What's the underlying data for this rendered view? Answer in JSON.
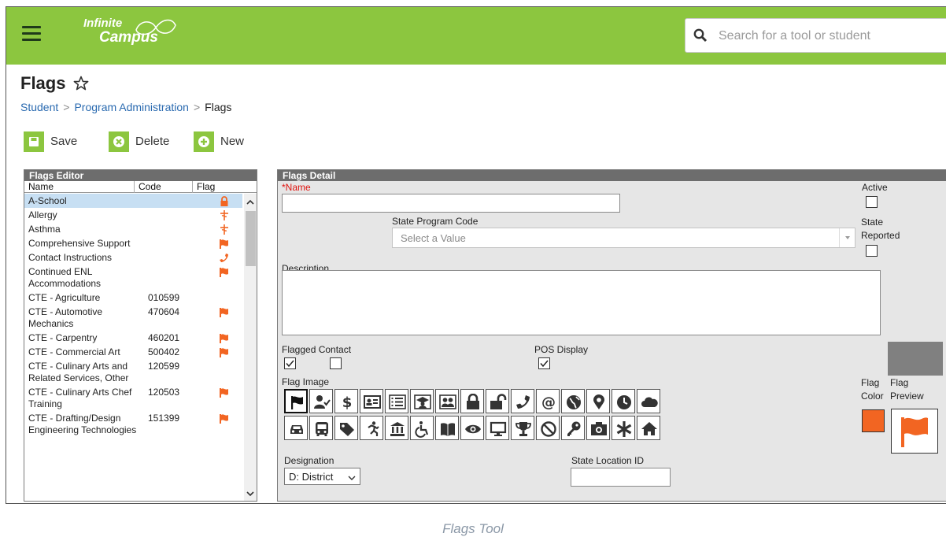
{
  "app": {
    "logo_line1": "Infinite",
    "logo_line2": "Campus",
    "search_placeholder": "Search for a tool or student"
  },
  "page": {
    "title": "Flags",
    "breadcrumb": [
      "Student",
      "Program Administration",
      "Flags"
    ]
  },
  "toolbar": {
    "save_label": "Save",
    "delete_label": "Delete",
    "new_label": "New"
  },
  "editor": {
    "title": "Flags Editor",
    "columns": [
      "Name",
      "Code",
      "Flag"
    ],
    "rows": [
      {
        "name": "A-School",
        "code": "",
        "flag": "lock-icon",
        "selected": true
      },
      {
        "name": "Allergy",
        "code": "",
        "flag": "medical-icon"
      },
      {
        "name": "Asthma",
        "code": "",
        "flag": "medical-icon"
      },
      {
        "name": "Comprehensive Support",
        "code": "",
        "flag": "flag-icon"
      },
      {
        "name": "Contact Instructions",
        "code": "",
        "flag": "phone-icon"
      },
      {
        "name": "Continued ENL Accommodations",
        "code": "",
        "flag": "flag-icon"
      },
      {
        "name": "CTE - Agriculture",
        "code": "010599",
        "flag": ""
      },
      {
        "name": "CTE - Automotive Mechanics",
        "code": "470604",
        "flag": "flag-icon"
      },
      {
        "name": "CTE - Carpentry",
        "code": "460201",
        "flag": "flag-icon"
      },
      {
        "name": "CTE - Commercial Art",
        "code": "500402",
        "flag": "flag-icon"
      },
      {
        "name": "CTE - Culinary Arts and Related Services, Other",
        "code": "120599",
        "flag": ""
      },
      {
        "name": "CTE - Culinary Arts Chef Training",
        "code": "120503",
        "flag": "flag-icon"
      },
      {
        "name": "CTE - Drafting/Design Engineering Technologies",
        "code": "151399",
        "flag": "flag-icon"
      }
    ]
  },
  "detail": {
    "title": "Flags Detail",
    "name_label": "*Name",
    "name_value": "",
    "active_label": "Active",
    "state_reported_label": "State Reported",
    "state_program_code_label": "State Program Code",
    "state_program_code_placeholder": "Select a Value",
    "description_label": "Description",
    "description_value": "",
    "flagged_contact_label": "Flagged Contact",
    "pos_display_label": "POS Display",
    "flag_image_label": "Flag Image",
    "flag_color_label": "Flag Color",
    "flag_preview_label": "Flag Preview",
    "designation_label": "Designation",
    "designation_value": "D: District",
    "state_location_id_label": "State Location ID",
    "state_location_id_value": "",
    "icons_row1": [
      "flag-icon",
      "user-check-icon",
      "dollar-icon",
      "id-card-icon",
      "checklist-icon",
      "graduate-icon",
      "group-icon",
      "lock-icon",
      "unlock-icon",
      "phone-icon",
      "at-icon",
      "globe-icon",
      "map-pin-icon",
      "clock-icon",
      "cloud-icon"
    ],
    "icons_row2": [
      "car-icon",
      "bus-icon",
      "tag-icon",
      "runner-icon",
      "building-icon",
      "wheelchair-icon",
      "book-icon",
      "eye-icon",
      "monitor-icon",
      "trophy-icon",
      "ban-icon",
      "key-icon",
      "camera-icon",
      "asterisk-icon",
      "home-icon"
    ],
    "selected_icon": "flag-icon",
    "flag_color": "#f26522"
  },
  "colors": {
    "brand_green": "#8cc63f",
    "flag_orange": "#f26522",
    "panel_header": "#6d6d6d"
  },
  "caption": "Flags Tool"
}
